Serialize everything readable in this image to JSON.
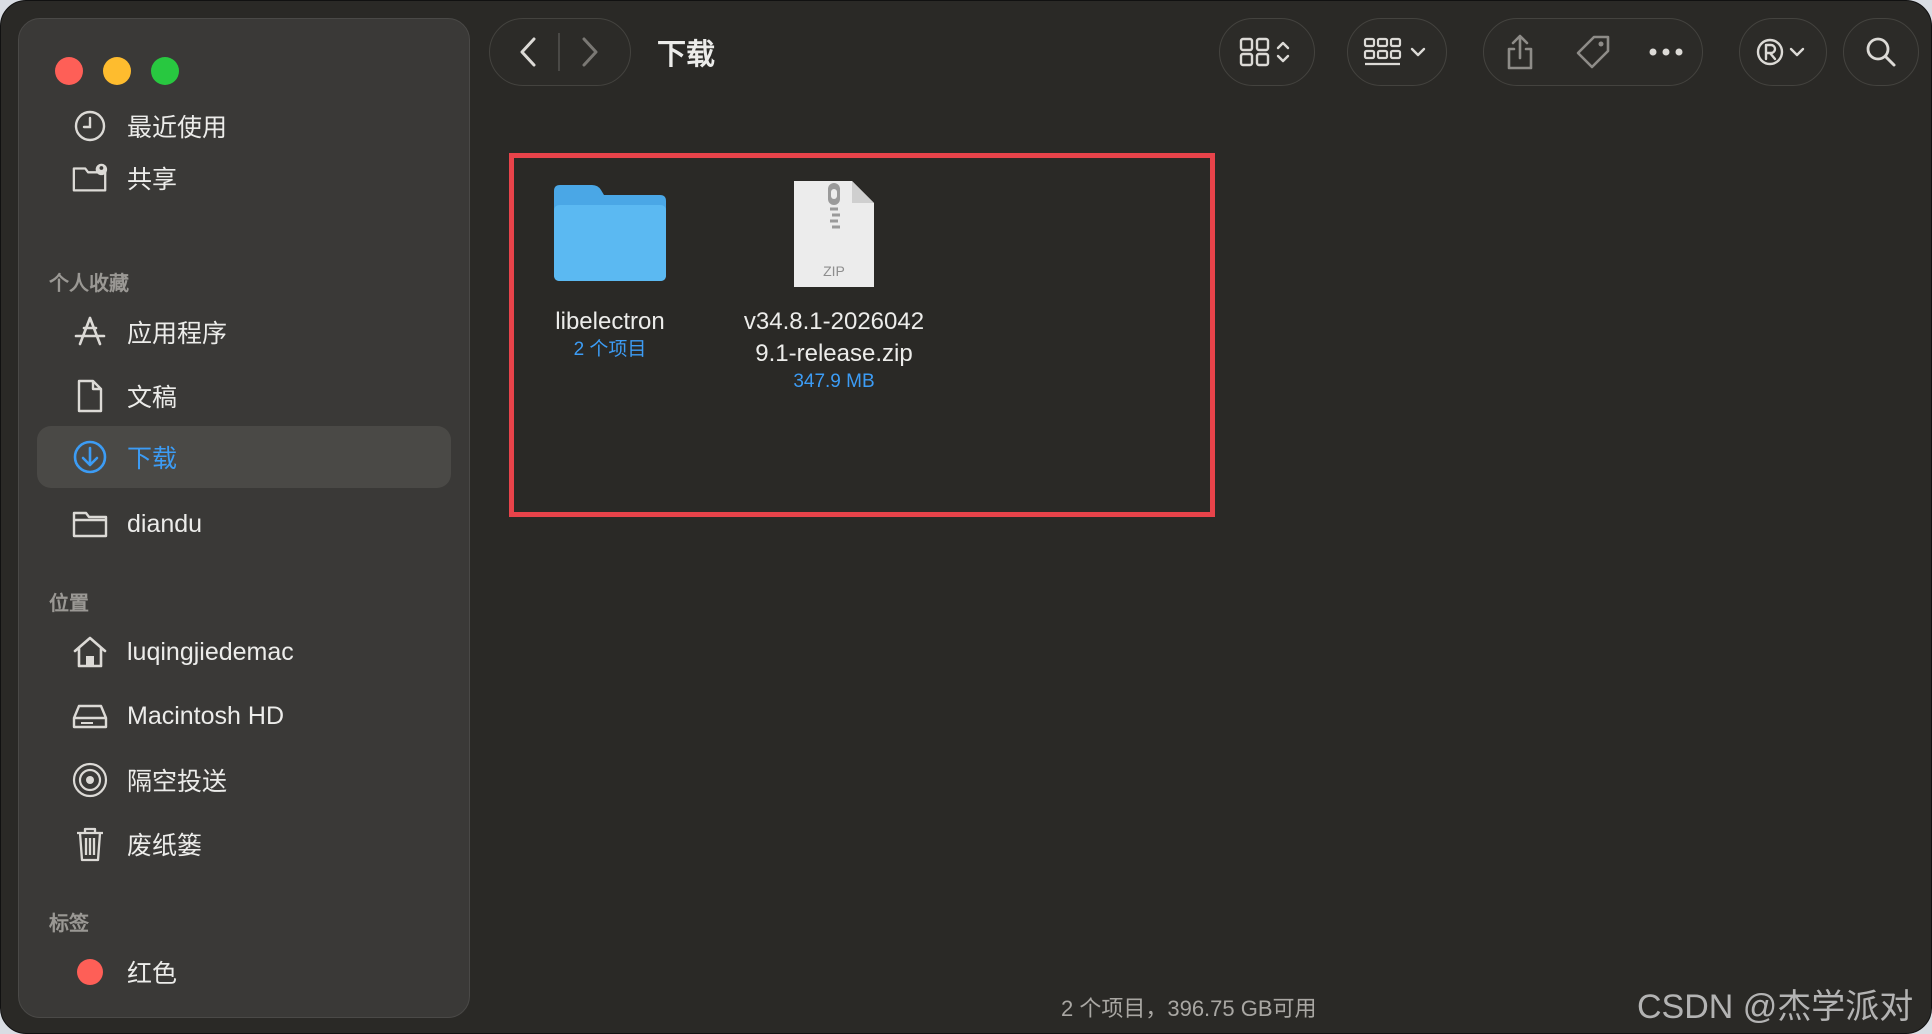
{
  "window": {
    "title": "下载"
  },
  "sidebar": {
    "recents": [
      {
        "label": "最近使用",
        "icon": "clock-icon"
      },
      {
        "label": "共享",
        "icon": "shared-folder-icon"
      }
    ],
    "favorites_title": "个人收藏",
    "favorites": [
      {
        "label": "应用程序",
        "icon": "app-store-icon"
      },
      {
        "label": "文稿",
        "icon": "document-icon"
      },
      {
        "label": "下载",
        "icon": "download-icon",
        "active": true
      },
      {
        "label": "diandu",
        "icon": "folder-icon"
      }
    ],
    "locations_title": "位置",
    "locations": [
      {
        "label": "luqingjiedemac",
        "icon": "home-icon"
      },
      {
        "label": "Macintosh HD",
        "icon": "disk-icon"
      },
      {
        "label": "隔空投送",
        "icon": "airdrop-icon"
      },
      {
        "label": "废纸篓",
        "icon": "trash-icon"
      }
    ],
    "tags_title": "标签",
    "tags": [
      {
        "label": "红色",
        "color": "#fe5f57"
      }
    ]
  },
  "files": [
    {
      "name": "libelectron",
      "meta": "2 个项目",
      "type": "folder"
    },
    {
      "name_line1": "v34.8.1-2026042",
      "name_line2": "9.1-release.zip",
      "meta": "347.9 MB",
      "type": "zip",
      "badge": "ZIP"
    }
  ],
  "status_bar": "2 个项目，396.75 GB可用",
  "watermark": "CSDN @杰学派对",
  "colors": {
    "accent": "#3c9cf5",
    "selection": "#e8434a",
    "background": "#2a2926"
  }
}
